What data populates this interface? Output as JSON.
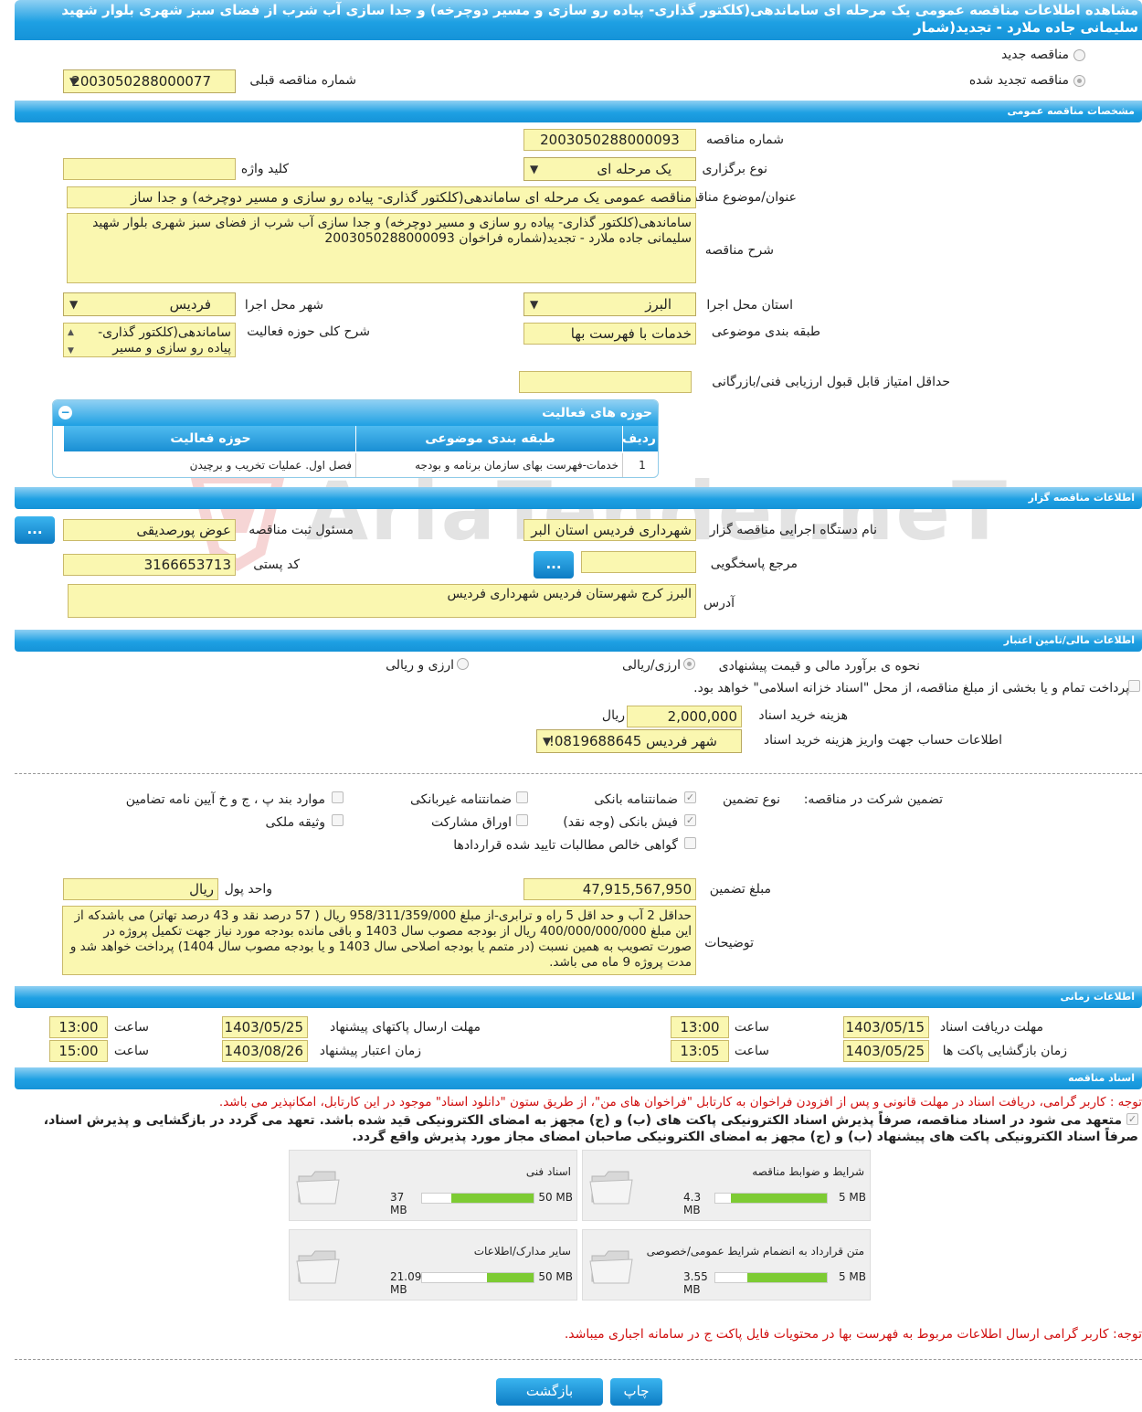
{
  "header": {
    "title": "مشاهده اطلاعات مناقصه عمومی یک مرحله ای ساماندهی(کلکتور گذاری- پیاده رو سازی و مسیر دوچرخه) و جدا سازی آب شرب از فضای سبز شهری بلوار شهید سلیمانی جاده ملارد - تجدید(شمار"
  },
  "tender_type": {
    "new_label": "مناقصه جدید",
    "renewed_label": "مناقصه تجدید شده",
    "prev_number_label": "شماره مناقصه قبلی",
    "prev_number": "2003050288000077"
  },
  "general": {
    "section": "مشخصات مناقصه عمومی",
    "number_label": "شماره مناقصه",
    "number": "2003050288000093",
    "method_label": "نوع برگزاری",
    "method": "یک مرحله ای",
    "keyword_label": "کلید واژه",
    "keyword": "",
    "subject_label": "عنوان/موضوع مناقصه",
    "subject": "مناقصه عمومی یک مرحله ای ساماندهی(کلکتور گذاری- پیاده رو سازی و مسیر دوچرخه)  و جدا ساز",
    "desc_label": "شرح مناقصه",
    "desc": "ساماندهی(کلکتور گذاری- پیاده رو سازی و مسیر دوچرخه)  و جدا سازی آب شرب از فضای سبز شهری بلوار شهید سلیمانی جاده ملارد - تجدید(شماره فراخوان 2003050288000093",
    "province_label": "استان محل اجرا",
    "province": "البرز",
    "city_label": "شهر محل اجرا",
    "city": "فردیس",
    "category_label": "طبقه بندی موضوعی",
    "category": "خدمات با فهرست بها",
    "activity_desc_label": "شرح کلی حوزه فعالیت",
    "activity_desc": "ساماندهی(کلکتور گذاری- پیاده رو سازی و مسیر",
    "min_score_label": "حداقل امتیاز قابل قبول ارزیابی فنی/بازرگانی",
    "min_score": ""
  },
  "activities": {
    "title": "حوزه های فعالیت",
    "headers": [
      "ردیف",
      "طبقه بندی موضوعی",
      "حوزه فعالیت"
    ],
    "rows": [
      [
        "1",
        "خدمات-فهرست بهای سازمان برنامه و بودجه",
        "فصل اول. عملیات تخریب و برچیدن"
      ]
    ]
  },
  "organizer": {
    "section": "اطلاعات مناقصه گزار",
    "org_label": "نام دستگاه اجرایی مناقصه گزار",
    "org": "شهرداری فردیس استان البر",
    "officer_label": "مسئول ثبت مناقصه",
    "officer": "عوض پورصدیقی",
    "ref_label": "مرجع پاسخگویی",
    "ref": "",
    "postal_label": "کد پستی",
    "postal": "3166653713",
    "address_label": "آدرس",
    "address": "البرز کرج شهرستان فردیس شهرداری فردیس",
    "btn": "..."
  },
  "finance": {
    "section": "اطلاعات مالی/تامین اعتبار",
    "estimate_label": "نحوه ی برآورد مالی و قیمت پیشنهادی",
    "opt_rial": "ارزی/ریالی",
    "opt_fx": "ارزی و ریالی",
    "treasury_label": "پرداخت تمام و یا بخشی از مبلغ مناقصه، از محل \"اسناد خزانه اسلامی\" خواهد بود.",
    "fee_label": "هزینه خرید اسناد",
    "fee": "2,000,000",
    "fee_unit": "ریال",
    "account_label": "اطلاعات حساب جهت واریز هزینه خرید اسناد",
    "account": "شهر فردیس 0819688645!"
  },
  "guarantee": {
    "label": "تضمین شرکت در مناقصه:",
    "type_label": "نوع تضمین",
    "items": {
      "bank": "ضمانتنامه بانکی",
      "nonbank": "ضمانتنامه غیربانکی",
      "bylaw": "موارد بند پ ، ج و خ آیین نامه تضامین",
      "cash": "فیش بانکی (وجه نقد)",
      "bonds": "اوراق مشارکت",
      "property": "وثیقه ملکی",
      "claims": "گواهی خالص مطالبات تایید شده قراردادها"
    },
    "amount_label": "مبلغ تضمین",
    "amount": "47,915,567,950",
    "currency_label": "واحد پول",
    "currency": "ریال",
    "notes_label": "توضیحات",
    "notes": "حداقل 2 آب و حد اقل 5 راه و ترابری-از مبلغ 958/311/359/000 ریال ( 57 درصد نقد و 43 درصد تهاتر) می باشدکه از این مبلغ 400/000/000/000 ریال از بودجه مصوب سال 1403  و باقی مانده بودجه مورد نیاز جهت تکمیل پروژه در صورت تصویب به همین نسبت (در متمم یا بودجه اصلاحی سال 1403 و یا بودجه مصوب سال 1404) پرداخت خواهد شد و مدت پروژه 9 ماه می باشد."
  },
  "timing": {
    "section": "اطلاعات زمانی",
    "receive_label": "مهلت دریافت اسناد",
    "receive_date": "1403/05/15",
    "receive_time": "13:00",
    "send_label": "مهلت ارسال پاکتهای پیشنهاد",
    "send_date": "1403/05/25",
    "send_time": "13:00",
    "open_label": "زمان بازگشایی پاکت ها",
    "open_date": "1403/05/25",
    "open_time": "13:05",
    "valid_label": "زمان اعتبار پیشنهاد",
    "valid_date": "1403/08/26",
    "valid_time": "15:00",
    "time_label": "ساعت"
  },
  "documents": {
    "section": "اسناد مناقصه",
    "note1": "توجه : کاربر گرامی، دریافت اسناد در مهلت قانونی و پس از افزودن فراخوان به کارتابل \"فراخوان های من\"، از طریق ستون \"دانلود اسناد\" موجود در این کارتابل، امکانپذیر می باشد.",
    "commit_line1": "متعهد می شود در اسناد مناقصه، صرفاً پذیرش اسناد الکترونیکی پاکت های (ب) و (ج) مجهز به امضای الکترونیکی قید شده باشد. تعهد می گردد در بازگشایی و پذیرش اسناد،",
    "commit_line2": "صرفاً اسناد الکترونیکی پاکت های پیشنهاد (ب) و (ج) مجهز به امضای الکترونیکی صاحبان امضای مجاز مورد پذیرش واقع گردد.",
    "files": [
      {
        "name": "شرایط و ضوابط مناقصه",
        "used": "4.3 MB",
        "max": "5 MB",
        "ratio": 0.86
      },
      {
        "name": "اسناد فنی",
        "used": "37 MB",
        "max": "50 MB",
        "ratio": 0.74
      },
      {
        "name": "متن قرارداد به انضمام شرایط عمومی/خصوصی",
        "used": "3.55 MB",
        "max": "5 MB",
        "ratio": 0.71
      },
      {
        "name": "سایر مدارک/اطلاعات",
        "used": "21.09 MB",
        "max": "50 MB",
        "ratio": 0.42
      }
    ],
    "note2": "توجه: کاربر گرامی ارسال اطلاعات مربوط به فهرست بها در محتویات فایل پاکت ج در سامانه اجباری میباشد."
  },
  "footer": {
    "back": "بازگشت",
    "print": "چاپ"
  },
  "watermark": "AriaTender.neT"
}
